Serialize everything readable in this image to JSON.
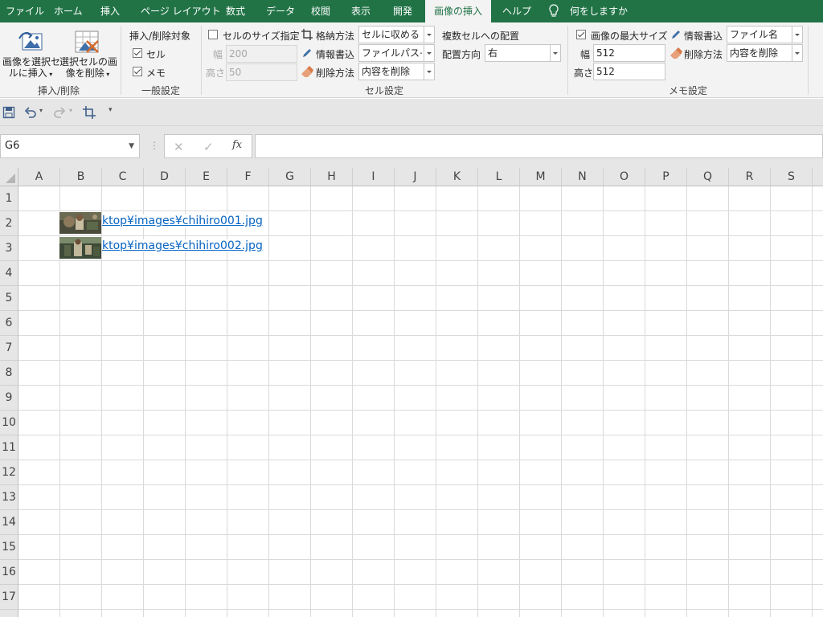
{
  "tabs": [
    "ファイル",
    "ホーム",
    "挿入",
    "ページ レイアウト",
    "数式",
    "データ",
    "校閲",
    "表示",
    "開発",
    "画像の挿入",
    "ヘルプ",
    "何をしますか"
  ],
  "ribbon": {
    "insert_cell_button_line1": "画像を選択セ",
    "insert_cell_button_line2": "ルに挿入",
    "delete_image_button_line1": "選択セルの画",
    "delete_image_button_line2": "像を削除",
    "group_insert_delete": "挿入/削除",
    "target_header": "挿入/削除対象",
    "target_cell": "セル",
    "target_memo": "メモ",
    "group_general": "一般設定",
    "cell_size_label": "セルのサイズ指定",
    "width_label": "幅",
    "width_value": "200",
    "height_label": "高さ",
    "height_value": "50",
    "storage_label": "格納方法",
    "storage_value": "セルに収める",
    "info_label": "情報書込",
    "info_value": "ファイルパス⋯",
    "delete_label": "削除方法",
    "delete_value": "内容を削除",
    "multi_header": "複数セルへの配置",
    "direction_label": "配置方向",
    "direction_value": "右",
    "group_cell": "セル設定",
    "max_size_label": "画像の最大サイズ",
    "memo_width_label": "幅",
    "memo_width_value": "512",
    "memo_height_label": "高さ",
    "memo_height_value": "512",
    "memo_info_label": "情報書込",
    "memo_info_value": "ファイル名",
    "memo_delete_label": "削除方法",
    "memo_delete_value": "内容を削除",
    "group_memo": "メモ設定"
  },
  "formula_bar": {
    "name_box": "G6",
    "cancel": "✕",
    "enter": "✓",
    "fx": "fx",
    "more": "⋮"
  },
  "columns": [
    "A",
    "B",
    "C",
    "D",
    "E",
    "F",
    "G",
    "H",
    "I",
    "J",
    "K",
    "L",
    "M",
    "N",
    "O",
    "P",
    "Q",
    "R",
    "S"
  ],
  "rows": [
    "1",
    "2",
    "3",
    "4",
    "5",
    "6",
    "7",
    "8",
    "9",
    "10",
    "11",
    "12",
    "13",
    "14",
    "15",
    "16",
    "17"
  ],
  "cells": {
    "b2_link": "ktop¥images¥chihiro001.jpg",
    "b3_link": "ktop¥images¥chihiro002.jpg"
  },
  "icons": {
    "save": "save-icon",
    "undo": "undo-icon",
    "redo": "redo-icon",
    "crop": "crop-icon",
    "lightbulb": "lightbulb-icon"
  },
  "colors": {
    "brand": "#217346",
    "link": "#0563c1"
  }
}
